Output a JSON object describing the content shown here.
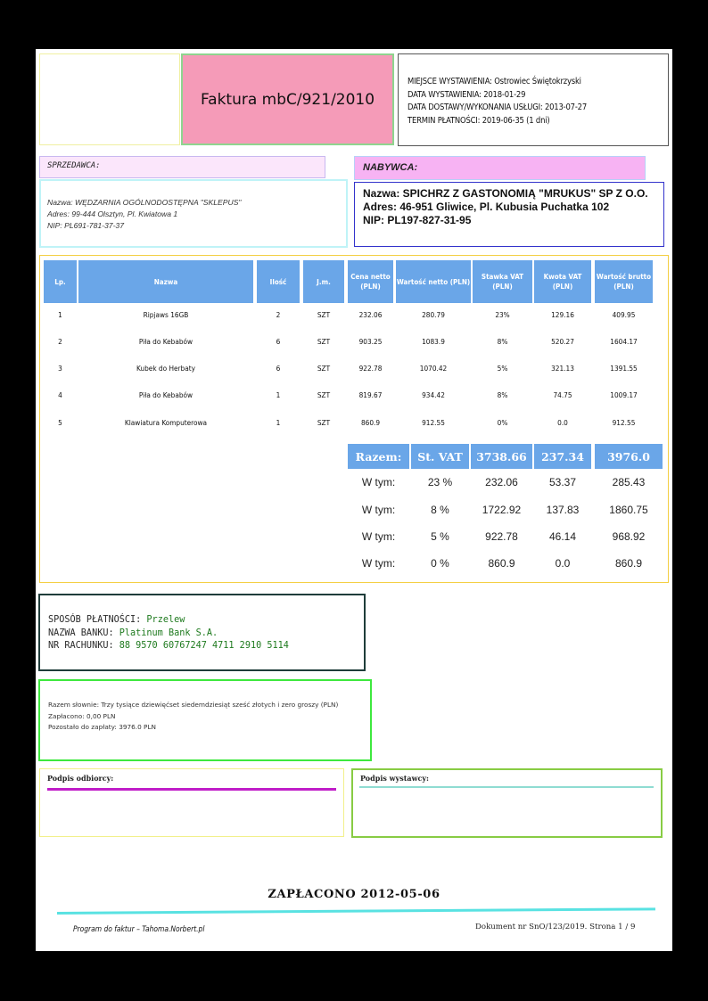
{
  "invoice": {
    "title": "Faktura mbC/921/2010",
    "meta": [
      "MIEJSCE WYSTAWIENIA: Ostrowiec Świętokrzyski",
      "DATA WYSTAWIENIA: 2018-01-29",
      "DATA DOSTAWY/WYKONANIA USŁUGI: 2013-07-27",
      "TERMIN PŁATNOŚCI: 2019-06-35 (1 dni)"
    ]
  },
  "seller": {
    "heading": "SPRZEDAWCA:",
    "lines": [
      "Nazwa: WĘDZARNIA OGÓLNODOSTĘPNA \"SKLEPUS\"",
      "Adres: 99-444 Olsztyn, Pl. Kwiatowa 1",
      "NIP: PL691-781-37-37"
    ]
  },
  "buyer": {
    "heading": "NABYWCA:",
    "lines": [
      "Nazwa: SPICHRZ Z GASTONOMIĄ \"MRUKUS\" SP Z O.O.",
      "Adres: 46-951 Gliwice, Pl. Kubusia Puchatka 102",
      "NIP: PL197-827-31-95"
    ]
  },
  "table": {
    "headers": [
      "Lp.",
      "Nazwa",
      "Ilość",
      "J.m.",
      "Cena netto (PLN)",
      "Wartość netto (PLN)",
      "Stawka VAT (PLN)",
      "Kwota VAT (PLN)",
      "Wartość brutto (PLN)"
    ],
    "rows": [
      [
        "1",
        "Ripjaws 16GB",
        "2",
        "SZT",
        "232.06",
        "280.79",
        "23%",
        "129.16",
        "409.95"
      ],
      [
        "2",
        "Piła do Kebabów",
        "6",
        "SZT",
        "903.25",
        "1083.9",
        "8%",
        "520.27",
        "1604.17"
      ],
      [
        "3",
        "Kubek do Herbaty",
        "6",
        "SZT",
        "922.78",
        "1070.42",
        "5%",
        "321.13",
        "1391.55"
      ],
      [
        "4",
        "Piła do Kebabów",
        "1",
        "SZT",
        "819.67",
        "934.42",
        "8%",
        "74.75",
        "1009.17"
      ],
      [
        "5",
        "Klawiatura Komputerowa",
        "1",
        "SZT",
        "860.9",
        "912.55",
        "0%",
        "0.0",
        "912.55"
      ]
    ],
    "summary_header": [
      "Razem:",
      "St. VAT",
      "3738.66",
      "237.34",
      "3976.0"
    ],
    "vat_rows": [
      [
        "W tym:",
        "23 %",
        "232.06",
        "53.37",
        "285.43"
      ],
      [
        "W tym:",
        "8 %",
        "1722.92",
        "137.83",
        "1860.75"
      ],
      [
        "W tym:",
        "5 %",
        "922.78",
        "46.14",
        "968.92"
      ],
      [
        "W tym:",
        "0 %",
        "860.9",
        "0.0",
        "860.9"
      ]
    ]
  },
  "payment": {
    "method_label": "SPOSÓB PŁATNOŚCI:",
    "method": "Przelew",
    "bank_label": "NAZWA BANKU:",
    "bank": "Platinum Bank S.A.",
    "account_label": "NR RACHUNKU:",
    "account": "88 9570 60767247 4711 2910 5114"
  },
  "summary_text": [
    "Razem słownie: Trzy tysiące dziewięćset siedemdziesiąt sześć złotych i zero groszy (PLN)",
    "Zapłacono: 0,00 PLN",
    "Pozostało do zapłaty: 3976.0 PLN"
  ],
  "signatures": {
    "receiver": "Podpis odbiorcy:",
    "issuer": "Podpis wystawcy:"
  },
  "paid_stamp": "ZAPŁACONO  2012-05-06",
  "footer": {
    "left": "Program do faktur – Tahoma.Norbert.pl",
    "right": "Dokument nr SnO/123/2019. Strona 1 / 9"
  }
}
